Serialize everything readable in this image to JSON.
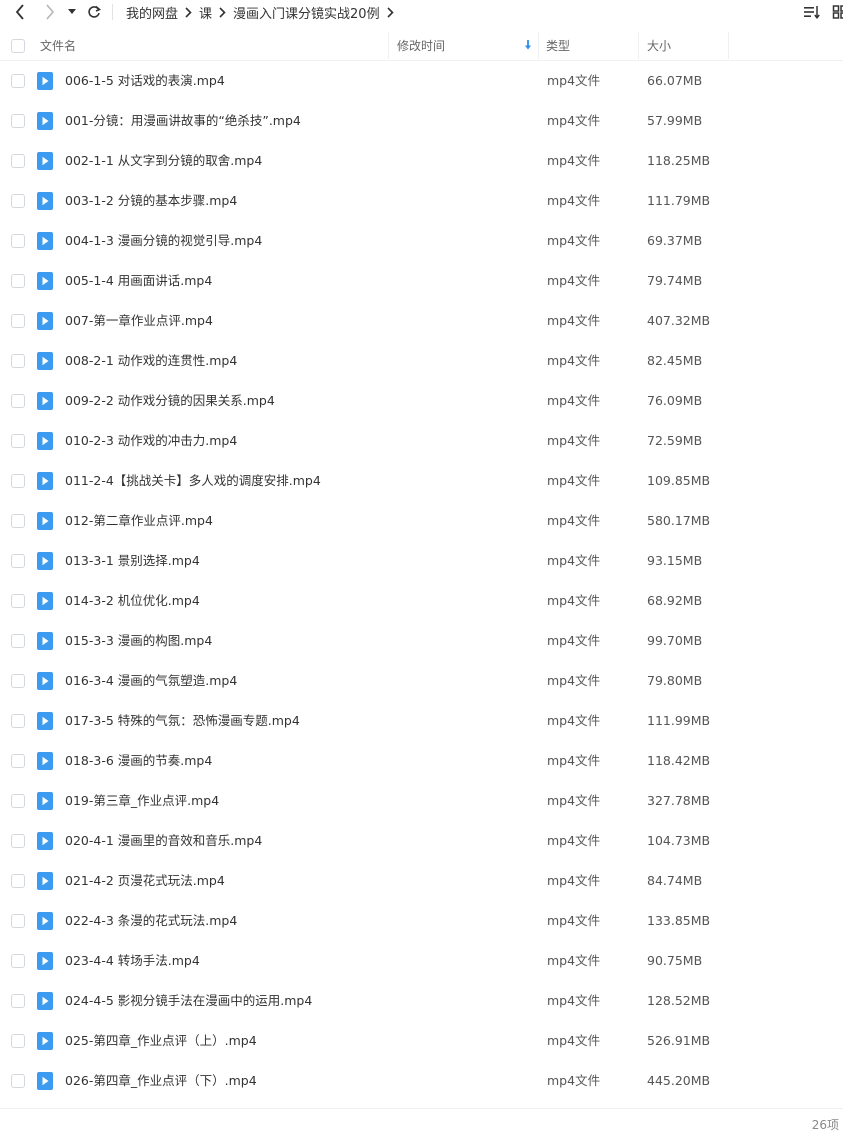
{
  "breadcrumb": {
    "items": [
      "我的网盘",
      "课",
      "漫画入门课分镜实战20例"
    ]
  },
  "toolbar": {
    "back_icon": "chevron-left-icon",
    "forward_icon": "chevron-right-icon",
    "history_icon": "caret-down-icon",
    "refresh_icon": "refresh-icon",
    "sort_icon": "sort-list-icon",
    "view_icon": "grid-view-icon"
  },
  "table": {
    "headers": {
      "name": "文件名",
      "modified": "修改时间",
      "type": "类型",
      "size": "大小"
    },
    "rows": [
      {
        "name": "006-1-5 对话戏的表演.mp4",
        "type": "mp4文件",
        "size": "66.07MB"
      },
      {
        "name": "001-分镜：用漫画讲故事的“绝杀技”.mp4",
        "type": "mp4文件",
        "size": "57.99MB"
      },
      {
        "name": "002-1-1 从文字到分镜的取舍.mp4",
        "type": "mp4文件",
        "size": "118.25MB"
      },
      {
        "name": "003-1-2 分镜的基本步骤.mp4",
        "type": "mp4文件",
        "size": "111.79MB"
      },
      {
        "name": "004-1-3 漫画分镜的视觉引导.mp4",
        "type": "mp4文件",
        "size": "69.37MB"
      },
      {
        "name": "005-1-4 用画面讲话.mp4",
        "type": "mp4文件",
        "size": "79.74MB"
      },
      {
        "name": "007-第一章作业点评.mp4",
        "type": "mp4文件",
        "size": "407.32MB"
      },
      {
        "name": "008-2-1 动作戏的连贯性.mp4",
        "type": "mp4文件",
        "size": "82.45MB"
      },
      {
        "name": "009-2-2 动作戏分镜的因果关系.mp4",
        "type": "mp4文件",
        "size": "76.09MB"
      },
      {
        "name": "010-2-3 动作戏的冲击力.mp4",
        "type": "mp4文件",
        "size": "72.59MB"
      },
      {
        "name": "011-2-4【挑战关卡】多人戏的调度安排.mp4",
        "type": "mp4文件",
        "size": "109.85MB"
      },
      {
        "name": "012-第二章作业点评.mp4",
        "type": "mp4文件",
        "size": "580.17MB"
      },
      {
        "name": "013-3-1 景别选择.mp4",
        "type": "mp4文件",
        "size": "93.15MB"
      },
      {
        "name": "014-3-2 机位优化.mp4",
        "type": "mp4文件",
        "size": "68.92MB"
      },
      {
        "name": "015-3-3 漫画的构图.mp4",
        "type": "mp4文件",
        "size": "99.70MB"
      },
      {
        "name": "016-3-4 漫画的气氛塑造.mp4",
        "type": "mp4文件",
        "size": "79.80MB"
      },
      {
        "name": "017-3-5 特殊的气氛：恐怖漫画专题.mp4",
        "type": "mp4文件",
        "size": "111.99MB"
      },
      {
        "name": "018-3-6 漫画的节奏.mp4",
        "type": "mp4文件",
        "size": "118.42MB"
      },
      {
        "name": "019-第三章_作业点评.mp4",
        "type": "mp4文件",
        "size": "327.78MB"
      },
      {
        "name": "020-4-1 漫画里的音效和音乐.mp4",
        "type": "mp4文件",
        "size": "104.73MB"
      },
      {
        "name": "021-4-2 页漫花式玩法.mp4",
        "type": "mp4文件",
        "size": "84.74MB"
      },
      {
        "name": "022-4-3 条漫的花式玩法.mp4",
        "type": "mp4文件",
        "size": "133.85MB"
      },
      {
        "name": "023-4-4 转场手法.mp4",
        "type": "mp4文件",
        "size": "90.75MB"
      },
      {
        "name": "024-4-5 影视分镜手法在漫画中的运用.mp4",
        "type": "mp4文件",
        "size": "128.52MB"
      },
      {
        "name": "025-第四章_作业点评（上）.mp4",
        "type": "mp4文件",
        "size": "526.91MB"
      },
      {
        "name": "026-第四章_作业点评（下）.mp4",
        "type": "mp4文件",
        "size": "445.20MB"
      }
    ]
  },
  "footer": {
    "count": "26项"
  },
  "colors": {
    "file_icon": "#3a9bf0",
    "sort_arrow": "#2b8ff0",
    "divider": "#eef0f4"
  }
}
